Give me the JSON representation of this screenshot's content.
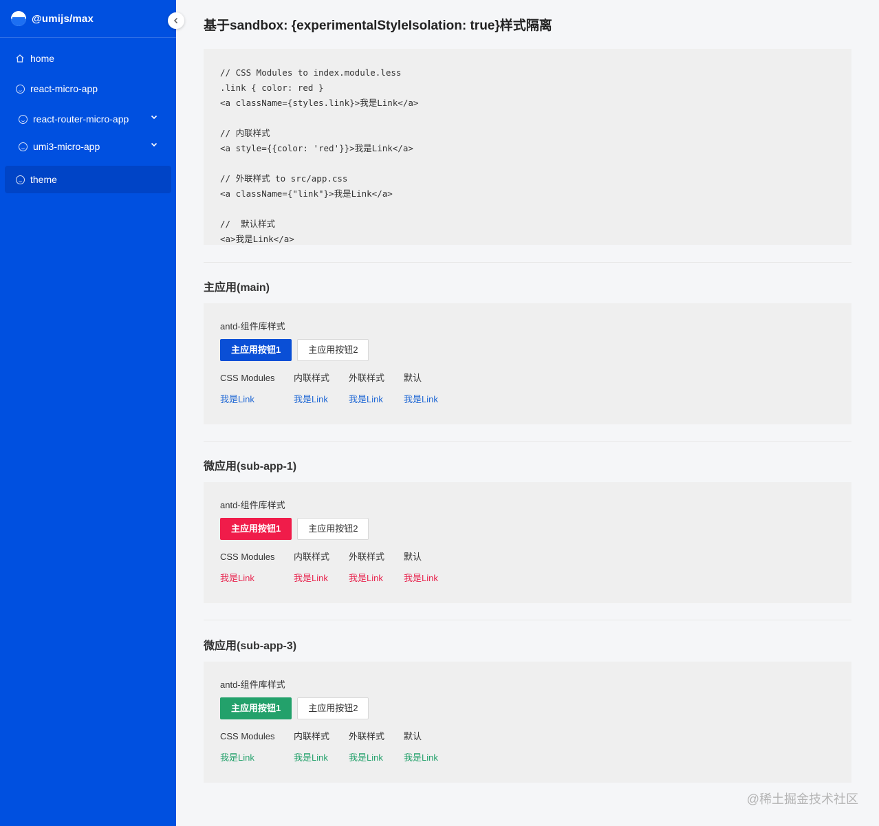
{
  "sidebar": {
    "brand": "@umijs/max",
    "items": [
      {
        "label": "home",
        "icon": "home-icon",
        "expandable": false,
        "active": false
      },
      {
        "label": "react-micro-app",
        "icon": "smile-icon",
        "expandable": false,
        "active": false
      },
      {
        "label": "react-router-micro-app",
        "icon": "smile-icon",
        "expandable": true,
        "active": false
      },
      {
        "label": "umi3-micro-app",
        "icon": "smile-icon",
        "expandable": true,
        "active": false
      },
      {
        "label": "theme",
        "icon": "smile-icon",
        "expandable": false,
        "active": true
      }
    ]
  },
  "page": {
    "title": "基于sandbox: {experimentalStyleIsolation: true}样式隔离"
  },
  "code": {
    "lines": [
      "// CSS Modules to index.module.less",
      ".link { color: red }",
      "<a className={styles.link}>我是Link</a>",
      "",
      "// 内联样式",
      "<a style={{color: 'red'}}>我是Link</a>",
      "",
      "// 外联样式 to src/app.css",
      "<a className={\"link\"}>我是Link</a>",
      "",
      "//  默认样式",
      "<a>我是Link</a>"
    ]
  },
  "sections": [
    {
      "title": "主应用(main)",
      "card_label": "antd-组件库样式",
      "primary_button": "主应用按钮1",
      "default_button": "主应用按钮2",
      "accent": "#0a4fd6",
      "link_color": "#1d66d4",
      "columns": [
        "CSS Modules",
        "内联样式",
        "外联样式",
        "默认"
      ],
      "links": [
        "我是Link",
        "我是Link",
        "我是Link",
        "我是Link"
      ]
    },
    {
      "title": "微应用(sub-app-1)",
      "card_label": "antd-组件库样式",
      "primary_button": "主应用按钮1",
      "default_button": "主应用按钮2",
      "accent": "#f01c4a",
      "link_color": "#e8264f",
      "columns": [
        "CSS Modules",
        "内联样式",
        "外联样式",
        "默认"
      ],
      "links": [
        "我是Link",
        "我是Link",
        "我是Link",
        "我是Link"
      ]
    },
    {
      "title": "微应用(sub-app-3)",
      "card_label": "antd-组件库样式",
      "primary_button": "主应用按钮1",
      "default_button": "主应用按钮2",
      "accent": "#23a16b",
      "link_color": "#23a16b",
      "columns": [
        "CSS Modules",
        "内联样式",
        "外联样式",
        "默认"
      ],
      "links": [
        "我是Link",
        "我是Link",
        "我是Link",
        "我是Link"
      ]
    }
  ],
  "watermark": "@稀土掘金技术社区",
  "colors": {
    "sidebar_bg": "#0050e0",
    "sidebar_active": "#0044c6",
    "page_bg": "#f5f6f8",
    "card_bg": "#efefef"
  }
}
